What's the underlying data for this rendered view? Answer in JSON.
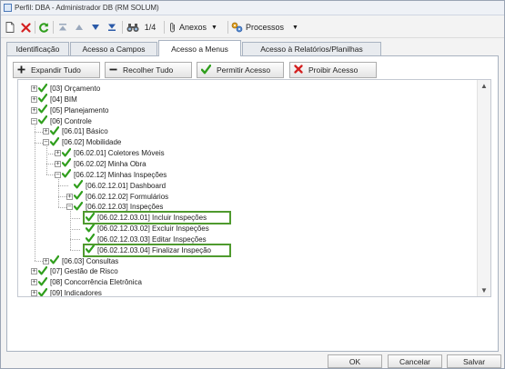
{
  "window": {
    "title": "Perfil: DBA - Administrador DB (RM SOLUM)"
  },
  "toolbar": {
    "record_counter": "1/4",
    "anexos_label": "Anexos",
    "processos_label": "Processos"
  },
  "tabs": [
    {
      "label": "Identificação"
    },
    {
      "label": "Acesso a Campos"
    },
    {
      "label": "Acesso a Menus"
    },
    {
      "label": "Acesso à Relatórios/Planilhas"
    }
  ],
  "actions": {
    "expand_all": "Expandir Tudo",
    "collapse_all": "Recolher Tudo",
    "allow_access": "Permitir Acesso",
    "deny_access": "Proibir Acesso"
  },
  "tree": {
    "nodes": [
      {
        "label": "[03] Orçamento",
        "expander": "+"
      },
      {
        "label": "[04] BIM",
        "expander": "+"
      },
      {
        "label": "[05] Planejamento",
        "expander": "+"
      },
      {
        "label": "[06] Controle",
        "expander": "-"
      },
      {
        "label": "[06.01] Básico",
        "expander": "+"
      },
      {
        "label": "[06.02] Mobilidade",
        "expander": "-"
      },
      {
        "label": "[06.02.01] Coletores Móveis",
        "expander": "+"
      },
      {
        "label": "[06.02.02] Minha Obra",
        "expander": "+"
      },
      {
        "label": "[06.02.12] Minhas Inspeções",
        "expander": "-"
      },
      {
        "label": "[06.02.12.01] Dashboard",
        "expander": ""
      },
      {
        "label": "[06.02.12.02] Formulários",
        "expander": "+"
      },
      {
        "label": "[06.02.12.03] Inspeções",
        "expander": "-"
      },
      {
        "label": "[06.02.12.03.01] Incluir Inspeções",
        "expander": ""
      },
      {
        "label": "[06.02.12.03.02] Excluir Inspeções",
        "expander": ""
      },
      {
        "label": "[06.02.12.03.03] Editar Inspeções",
        "expander": ""
      },
      {
        "label": "[06.02.12.03.04] Finalizar Inspeção",
        "expander": ""
      },
      {
        "label": "[06.03] Consultas",
        "expander": "+"
      },
      {
        "label": "[07] Gestão de Risco",
        "expander": "+"
      },
      {
        "label": "[08] Concorrência Eletrônica",
        "expander": "+"
      },
      {
        "label": "[09] Indicadores",
        "expander": "+"
      }
    ]
  },
  "footer": {
    "ok": "OK",
    "cancel": "Cancelar",
    "save": "Salvar"
  },
  "colors": {
    "check_green": "#2f9e1c",
    "highlight_green": "#4f9a2e",
    "deny_red": "#d42020"
  }
}
